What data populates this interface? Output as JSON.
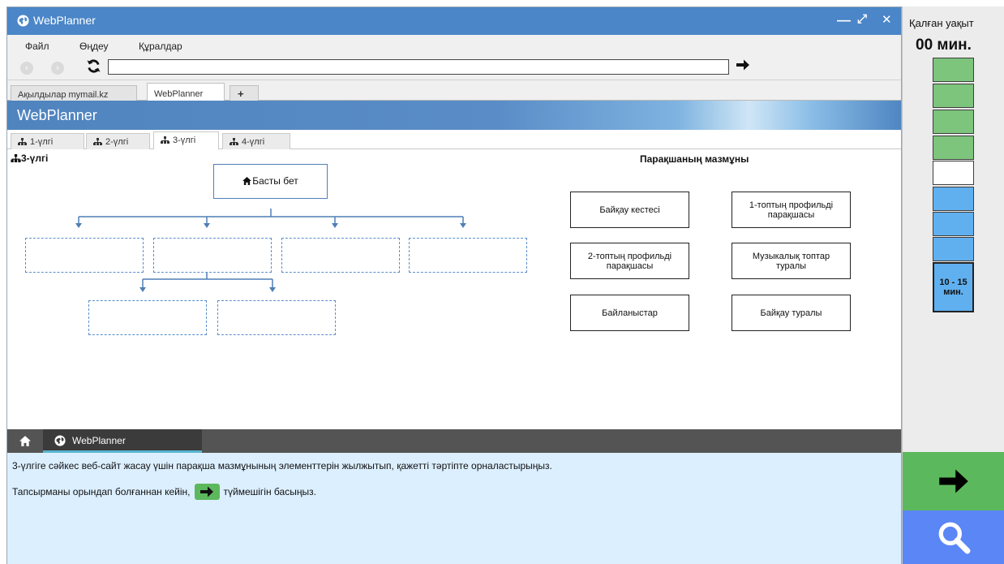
{
  "window": {
    "title": "WebPlanner",
    "controls": [
      "—",
      "⤢",
      "✕"
    ]
  },
  "menu": [
    "Файл",
    "Өңдеу",
    "Құралдар"
  ],
  "browser": {
    "url": "",
    "tabs": [
      "Ақылдылар mymail.kz",
      "WebPlanner",
      "+"
    ]
  },
  "app": {
    "banner_title": "WebPlanner",
    "model_tabs": [
      "1-үлгі",
      "2-үлгі",
      "3-үлгі",
      "4-үлгі"
    ],
    "active_model": "3-үлгі"
  },
  "workspace": {
    "model_title": "3-үлгі",
    "home_page": "Басты бет",
    "content_title": "Парақшаның мазмұны",
    "content_items": [
      "Байқау кестесі",
      "1-топтың профильді парақшасы",
      "2-топтың профильді парақшасы",
      "Музыкалық топтар туралы",
      "Байланыстар",
      "Байқау туралы"
    ]
  },
  "dock": {
    "tab_label": "WebPlanner"
  },
  "instructions": {
    "line1": "3-үлгіге сәйкес веб-сайт жасау үшін парақша мазмұнының элементтерін жылжытып, қажетті тәртіпте орналастырыңыз.",
    "line2_before": "Тапсырманы орындап болғаннан кейін,",
    "line2_after": "түймешігін басыңыз."
  },
  "side": {
    "remaining_label": "Қалған уақыт",
    "timer": "00 мин.",
    "progress": [
      "done",
      "done",
      "done",
      "done",
      "empty",
      "pending",
      "pending",
      "pending"
    ],
    "current_block": "10 - 15 мин."
  },
  "colors": {
    "titlebar": "#4a86c8",
    "progress_done": "#7dc47d",
    "progress_pending": "#60b0f0",
    "next_button": "#5cb85c",
    "search_button": "#5b86f5",
    "instructions_bg": "#dcefff"
  }
}
